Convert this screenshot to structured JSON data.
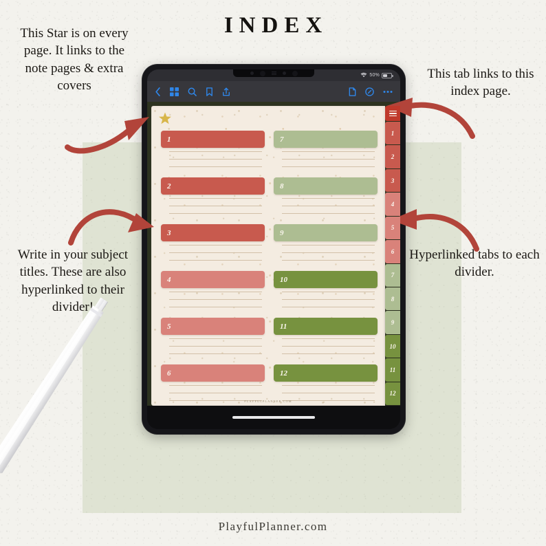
{
  "page": {
    "title": "INDEX",
    "footer_brand": "PlayfulPlanner.com",
    "background_color": "#f3f2ed",
    "accent_block_color": "#dfe3d2"
  },
  "annotations": [
    {
      "id": "star",
      "text": "This Star is on every page. It links to the note pages & extra covers"
    },
    {
      "id": "tab",
      "text": "This tab links to this index page."
    },
    {
      "id": "subjects",
      "text": "Write in your subject titles. These are also hyperlinked to their divider!"
    },
    {
      "id": "dividers",
      "text": "Hyperlinked tabs to each divider."
    }
  ],
  "arrow_color": "#b2443a",
  "tablet": {
    "status_bar": {
      "wifi_icon": "wifi-icon",
      "battery_percent": "50%",
      "battery_level": 50
    },
    "toolbar": {
      "left_icons": [
        {
          "name": "back-chevron-icon",
          "label": "Back"
        },
        {
          "name": "thumbnails-grid-icon",
          "label": "Page Thumbnails"
        },
        {
          "name": "search-icon",
          "label": "Search"
        },
        {
          "name": "bookmark-icon",
          "label": "Bookmark"
        },
        {
          "name": "share-icon",
          "label": "Share"
        }
      ],
      "right_icons": [
        {
          "name": "new-page-icon",
          "label": "New Page"
        },
        {
          "name": "edit-pen-icon",
          "label": "Edit"
        },
        {
          "name": "more-options-icon",
          "label": "More"
        }
      ],
      "accent_color": "#2f86e8"
    },
    "planner": {
      "star_icon": "star-icon",
      "page_surround_color": "#2d3320",
      "page_color": "#f4ece1",
      "footer_text": "PLAYFULPLANNER.COM",
      "writing_lines_per_entry": 3,
      "left_column": [
        {
          "number": "1",
          "color": "#c85a4e"
        },
        {
          "number": "2",
          "color": "#c85a4e"
        },
        {
          "number": "3",
          "color": "#c85a4e"
        },
        {
          "number": "4",
          "color": "#d9827a"
        },
        {
          "number": "5",
          "color": "#d9827a"
        },
        {
          "number": "6",
          "color": "#d9827a"
        }
      ],
      "right_column": [
        {
          "number": "7",
          "color": "#adbd92"
        },
        {
          "number": "8",
          "color": "#adbd92"
        },
        {
          "number": "9",
          "color": "#adbd92"
        },
        {
          "number": "10",
          "color": "#77923f"
        },
        {
          "number": "11",
          "color": "#77923f"
        },
        {
          "number": "12",
          "color": "#77923f"
        }
      ]
    },
    "side_tabs": {
      "menu_tab": {
        "name": "menu-tab",
        "icon": "hamburger-icon",
        "color": "#c0392b"
      },
      "items": [
        {
          "number": "1",
          "color": "#c85a4e"
        },
        {
          "number": "2",
          "color": "#c85a4e"
        },
        {
          "number": "3",
          "color": "#c85a4e"
        },
        {
          "number": "4",
          "color": "#d9827a"
        },
        {
          "number": "5",
          "color": "#d9827a"
        },
        {
          "number": "6",
          "color": "#d9827a"
        },
        {
          "number": "7",
          "color": "#adbd92"
        },
        {
          "number": "8",
          "color": "#adbd92"
        },
        {
          "number": "9",
          "color": "#adbd92"
        },
        {
          "number": "10",
          "color": "#77923f"
        },
        {
          "number": "11",
          "color": "#77923f"
        },
        {
          "number": "12",
          "color": "#77923f"
        }
      ]
    }
  }
}
